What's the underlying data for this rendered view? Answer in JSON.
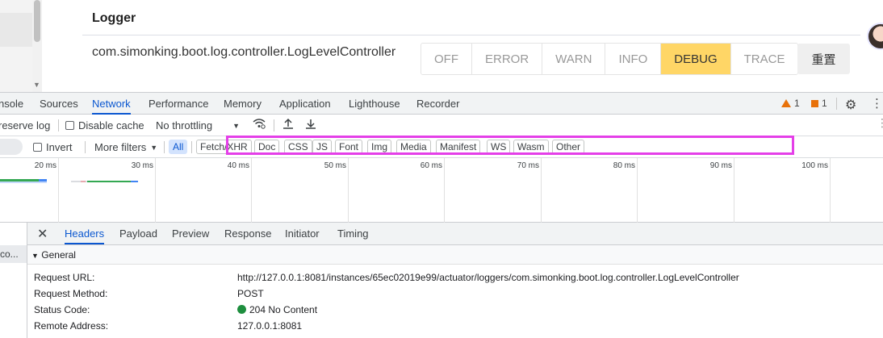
{
  "app": {
    "logger_title": "Logger",
    "logger_name": "com.simonking.boot.log.controller.LogLevelController",
    "levels": [
      "OFF",
      "ERROR",
      "WARN",
      "INFO",
      "DEBUG",
      "TRACE"
    ],
    "active_level": "DEBUG",
    "reset_label": "重置"
  },
  "devtools": {
    "tabs": [
      "nsole",
      "Sources",
      "Network",
      "Performance",
      "Memory",
      "Application",
      "Lighthouse",
      "Recorder"
    ],
    "active_tab": "Network",
    "warnings_count": "1",
    "issues_count": "1",
    "toolbar": {
      "preserve_log": "reserve log",
      "disable_cache": "Disable cache",
      "throttling": "No throttling"
    },
    "filter_bar": {
      "invert": "Invert",
      "more_filters": "More filters",
      "chips": [
        "All",
        "Fetch/XHR",
        "Doc",
        "CSS",
        "JS",
        "Font",
        "Img",
        "Media",
        "Manifest",
        "WS",
        "Wasm",
        "Other"
      ],
      "active_chip": "All"
    },
    "timeline_ticks": [
      "20 ms",
      "30 ms",
      "40 ms",
      "50 ms",
      "60 ms",
      "70 ms",
      "80 ms",
      "90 ms",
      "100 ms"
    ],
    "request_list_item": "co...",
    "detail_tabs": [
      "Headers",
      "Payload",
      "Preview",
      "Response",
      "Initiator",
      "Timing"
    ],
    "active_detail_tab": "Headers",
    "general_section": "General",
    "headers": [
      {
        "key": "Request URL:",
        "value": "http://127.0.0.1:8081/instances/65ec02019e99/actuator/loggers/com.simonking.boot.log.controller.LogLevelController"
      },
      {
        "key": "Request Method:",
        "value": "POST"
      },
      {
        "key": "Status Code:",
        "value": "204 No Content"
      },
      {
        "key": "Remote Address:",
        "value": "127.0.0.1:8081"
      }
    ]
  },
  "colors": {
    "accent": "#0b57d0",
    "active_level_bg": "#ffd666",
    "highlight_box": "#e43fe8",
    "status_ok": "#1e8e3e",
    "warning": "#e8710a"
  }
}
